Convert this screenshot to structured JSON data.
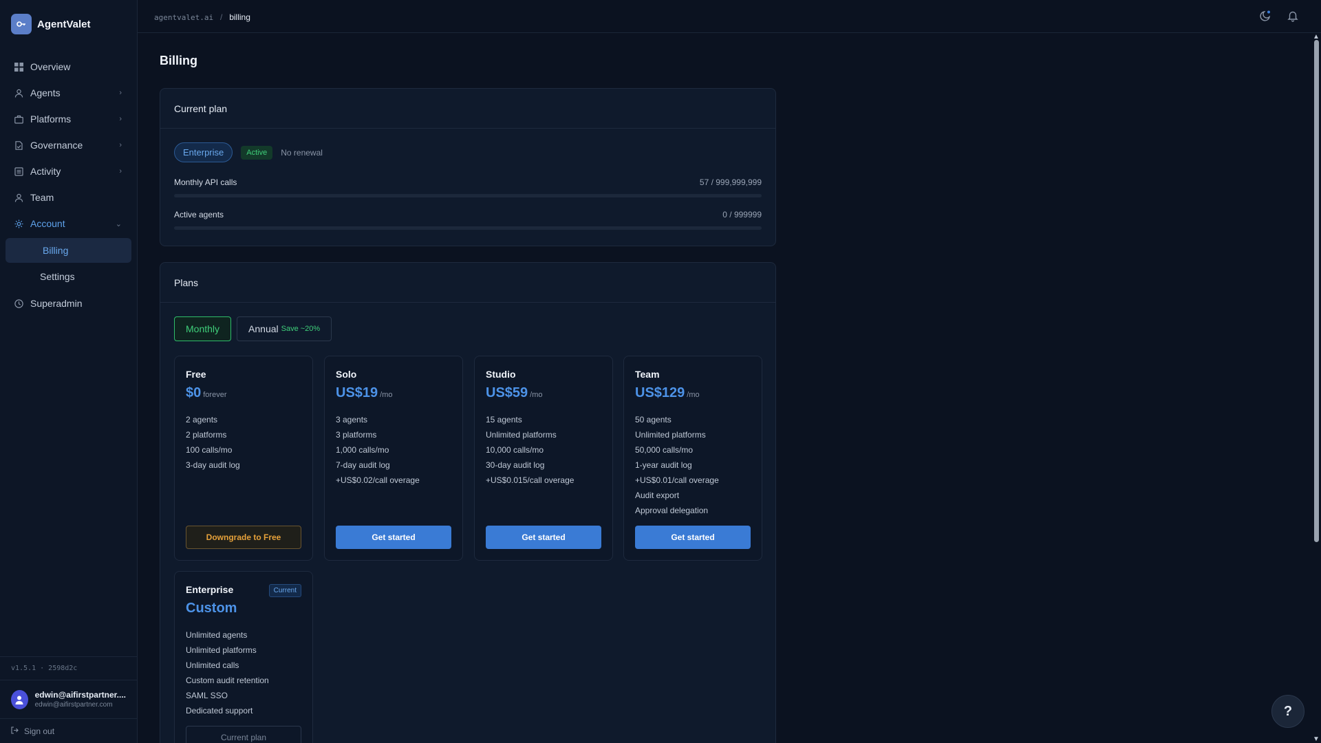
{
  "app": {
    "name": "AgentValet"
  },
  "sidebar": {
    "items": [
      {
        "label": "Overview",
        "icon": "grid-icon",
        "chevron": ""
      },
      {
        "label": "Agents",
        "icon": "user-icon",
        "chevron": "›"
      },
      {
        "label": "Platforms",
        "icon": "briefcase-icon",
        "chevron": "›"
      },
      {
        "label": "Governance",
        "icon": "document-check-icon",
        "chevron": "›"
      },
      {
        "label": "Activity",
        "icon": "list-icon",
        "chevron": "›"
      },
      {
        "label": "Team",
        "icon": "user-icon",
        "chevron": ""
      },
      {
        "label": "Account",
        "icon": "gear-icon",
        "chevron": "⌄"
      }
    ],
    "sub_items": [
      {
        "label": "Billing",
        "selected": true
      },
      {
        "label": "Settings",
        "selected": false
      }
    ],
    "superadmin": {
      "label": "Superadmin",
      "icon": "clock-icon"
    },
    "version": "v1.5.1 · 2598d2c",
    "user": {
      "name": "edwin@aifirstpartner....",
      "email": "edwin@aifirstpartner.com"
    },
    "signout": "Sign out"
  },
  "breadcrumb": {
    "root": "agentvalet.ai",
    "sep": "/",
    "current": "billing"
  },
  "page": {
    "title": "Billing"
  },
  "current_plan": {
    "heading": "Current plan",
    "plan": "Enterprise",
    "status": "Active",
    "renewal": "No renewal",
    "usage": [
      {
        "label": "Monthly API calls",
        "value": "57 / 999,999,999",
        "fraction": 0.0
      },
      {
        "label": "Active agents",
        "value": "0 / 999999",
        "fraction": 0.0
      }
    ]
  },
  "plans": {
    "heading": "Plans",
    "toggle": {
      "monthly": "Monthly",
      "annual": "Annual",
      "annual_save": "Save ~20%",
      "selected": "monthly"
    },
    "cards": [
      {
        "name": "Free",
        "price": "$0",
        "unit": "forever",
        "features": [
          "2 agents",
          "2 platforms",
          "100 calls/mo",
          "3-day audit log"
        ],
        "button": "Downgrade to Free",
        "button_style": "downgrade"
      },
      {
        "name": "Solo",
        "price": "US$19",
        "unit": "/mo",
        "features": [
          "3 agents",
          "3 platforms",
          "1,000 calls/mo",
          "7-day audit log",
          "+US$0.02/call overage"
        ],
        "button": "Get started",
        "button_style": "primary"
      },
      {
        "name": "Studio",
        "price": "US$59",
        "unit": "/mo",
        "features": [
          "15 agents",
          "Unlimited platforms",
          "10,000 calls/mo",
          "30-day audit log",
          "+US$0.015/call overage"
        ],
        "button": "Get started",
        "button_style": "primary"
      },
      {
        "name": "Team",
        "price": "US$129",
        "unit": "/mo",
        "features": [
          "50 agents",
          "Unlimited platforms",
          "50,000 calls/mo",
          "1-year audit log",
          "+US$0.01/call overage",
          "Audit export",
          "Approval delegation"
        ],
        "button": "Get started",
        "button_style": "primary"
      },
      {
        "name": "Enterprise",
        "price": "Custom",
        "unit": "",
        "badge": "Current",
        "features": [
          "Unlimited agents",
          "Unlimited platforms",
          "Unlimited calls",
          "Custom audit retention",
          "SAML SSO",
          "Dedicated support"
        ],
        "button": "Current plan",
        "button_style": "current"
      }
    ]
  },
  "help": {
    "label": "?"
  },
  "colors": {
    "accent": "#3a7bd5",
    "success": "#3fcf7a",
    "warning": "#e6a13a",
    "background": "#0b1220"
  }
}
